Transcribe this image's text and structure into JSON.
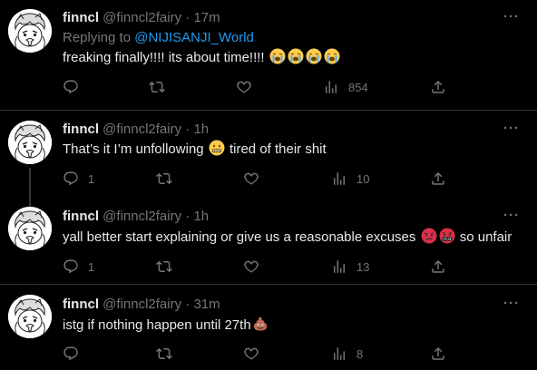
{
  "colors": {
    "background": "#000000",
    "primary_text": "#e7e9ea",
    "secondary_text": "#71767b",
    "link": "#1d9bf0",
    "divider": "#2f3336"
  },
  "tweets": [
    {
      "name": "finncl",
      "handle": "@finncl2fairy",
      "dot": "·",
      "time": "17m",
      "more": "···",
      "replying_prefix": "Replying to ",
      "replying_to": "@NIJISANJI_World",
      "text": "freaking finally!!!! its about time!!!!",
      "emojis": [
        "loudly-crying-face-emoji",
        "loudly-crying-face-emoji",
        "loudly-crying-face-emoji",
        "loudly-crying-face-emoji"
      ],
      "reply_count": "",
      "retweet_count": "",
      "like_count": "",
      "views": "854"
    },
    {
      "name": "finncl",
      "handle": "@finncl2fairy",
      "dot": "·",
      "time": "1h",
      "more": "···",
      "text_before": "That’s it I’m unfollowing ",
      "emoji": "grimacing-face-emoji",
      "text_after": " tired of their shit",
      "reply_count": "1",
      "retweet_count": "",
      "like_count": "",
      "views": "10"
    },
    {
      "name": "finncl",
      "handle": "@finncl2fairy",
      "dot": "·",
      "time": "1h",
      "more": "···",
      "text_before": "yall better start explaining or give us a reasonable excuses ",
      "emojis": [
        "pouting-face-emoji",
        "face-with-symbols-emoji"
      ],
      "text_after": " so unfair",
      "reply_count": "1",
      "retweet_count": "",
      "like_count": "",
      "views": "13"
    },
    {
      "name": "finncl",
      "handle": "@finncl2fairy",
      "dot": "·",
      "time": "31m",
      "more": "···",
      "text_before": "istg if nothing happen until 27th",
      "emoji": "pile-of-poo-emoji",
      "reply_count": "",
      "retweet_count": "",
      "like_count": "",
      "views": "8"
    }
  ]
}
